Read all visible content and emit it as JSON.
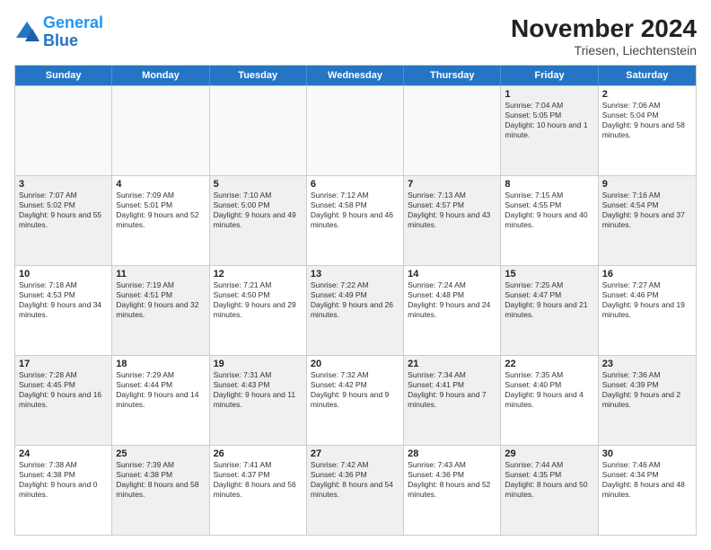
{
  "logo": {
    "line1": "General",
    "line2": "Blue"
  },
  "title": "November 2024",
  "location": "Triesen, Liechtenstein",
  "header_days": [
    "Sunday",
    "Monday",
    "Tuesday",
    "Wednesday",
    "Thursday",
    "Friday",
    "Saturday"
  ],
  "rows": [
    [
      {
        "day": "",
        "text": "",
        "empty": true
      },
      {
        "day": "",
        "text": "",
        "empty": true
      },
      {
        "day": "",
        "text": "",
        "empty": true
      },
      {
        "day": "",
        "text": "",
        "empty": true
      },
      {
        "day": "",
        "text": "",
        "empty": true
      },
      {
        "day": "1",
        "text": "Sunrise: 7:04 AM\nSunset: 5:05 PM\nDaylight: 10 hours and 1 minute.",
        "empty": false,
        "shaded": true
      },
      {
        "day": "2",
        "text": "Sunrise: 7:06 AM\nSunset: 5:04 PM\nDaylight: 9 hours and 58 minutes.",
        "empty": false,
        "shaded": false
      }
    ],
    [
      {
        "day": "3",
        "text": "Sunrise: 7:07 AM\nSunset: 5:02 PM\nDaylight: 9 hours and 55 minutes.",
        "empty": false,
        "shaded": true
      },
      {
        "day": "4",
        "text": "Sunrise: 7:09 AM\nSunset: 5:01 PM\nDaylight: 9 hours and 52 minutes.",
        "empty": false,
        "shaded": false
      },
      {
        "day": "5",
        "text": "Sunrise: 7:10 AM\nSunset: 5:00 PM\nDaylight: 9 hours and 49 minutes.",
        "empty": false,
        "shaded": true
      },
      {
        "day": "6",
        "text": "Sunrise: 7:12 AM\nSunset: 4:58 PM\nDaylight: 9 hours and 46 minutes.",
        "empty": false,
        "shaded": false
      },
      {
        "day": "7",
        "text": "Sunrise: 7:13 AM\nSunset: 4:57 PM\nDaylight: 9 hours and 43 minutes.",
        "empty": false,
        "shaded": true
      },
      {
        "day": "8",
        "text": "Sunrise: 7:15 AM\nSunset: 4:55 PM\nDaylight: 9 hours and 40 minutes.",
        "empty": false,
        "shaded": false
      },
      {
        "day": "9",
        "text": "Sunrise: 7:16 AM\nSunset: 4:54 PM\nDaylight: 9 hours and 37 minutes.",
        "empty": false,
        "shaded": true
      }
    ],
    [
      {
        "day": "10",
        "text": "Sunrise: 7:18 AM\nSunset: 4:53 PM\nDaylight: 9 hours and 34 minutes.",
        "empty": false,
        "shaded": false
      },
      {
        "day": "11",
        "text": "Sunrise: 7:19 AM\nSunset: 4:51 PM\nDaylight: 9 hours and 32 minutes.",
        "empty": false,
        "shaded": true
      },
      {
        "day": "12",
        "text": "Sunrise: 7:21 AM\nSunset: 4:50 PM\nDaylight: 9 hours and 29 minutes.",
        "empty": false,
        "shaded": false
      },
      {
        "day": "13",
        "text": "Sunrise: 7:22 AM\nSunset: 4:49 PM\nDaylight: 9 hours and 26 minutes.",
        "empty": false,
        "shaded": true
      },
      {
        "day": "14",
        "text": "Sunrise: 7:24 AM\nSunset: 4:48 PM\nDaylight: 9 hours and 24 minutes.",
        "empty": false,
        "shaded": false
      },
      {
        "day": "15",
        "text": "Sunrise: 7:25 AM\nSunset: 4:47 PM\nDaylight: 9 hours and 21 minutes.",
        "empty": false,
        "shaded": true
      },
      {
        "day": "16",
        "text": "Sunrise: 7:27 AM\nSunset: 4:46 PM\nDaylight: 9 hours and 19 minutes.",
        "empty": false,
        "shaded": false
      }
    ],
    [
      {
        "day": "17",
        "text": "Sunrise: 7:28 AM\nSunset: 4:45 PM\nDaylight: 9 hours and 16 minutes.",
        "empty": false,
        "shaded": true
      },
      {
        "day": "18",
        "text": "Sunrise: 7:29 AM\nSunset: 4:44 PM\nDaylight: 9 hours and 14 minutes.",
        "empty": false,
        "shaded": false
      },
      {
        "day": "19",
        "text": "Sunrise: 7:31 AM\nSunset: 4:43 PM\nDaylight: 9 hours and 11 minutes.",
        "empty": false,
        "shaded": true
      },
      {
        "day": "20",
        "text": "Sunrise: 7:32 AM\nSunset: 4:42 PM\nDaylight: 9 hours and 9 minutes.",
        "empty": false,
        "shaded": false
      },
      {
        "day": "21",
        "text": "Sunrise: 7:34 AM\nSunset: 4:41 PM\nDaylight: 9 hours and 7 minutes.",
        "empty": false,
        "shaded": true
      },
      {
        "day": "22",
        "text": "Sunrise: 7:35 AM\nSunset: 4:40 PM\nDaylight: 9 hours and 4 minutes.",
        "empty": false,
        "shaded": false
      },
      {
        "day": "23",
        "text": "Sunrise: 7:36 AM\nSunset: 4:39 PM\nDaylight: 9 hours and 2 minutes.",
        "empty": false,
        "shaded": true
      }
    ],
    [
      {
        "day": "24",
        "text": "Sunrise: 7:38 AM\nSunset: 4:38 PM\nDaylight: 9 hours and 0 minutes.",
        "empty": false,
        "shaded": false
      },
      {
        "day": "25",
        "text": "Sunrise: 7:39 AM\nSunset: 4:38 PM\nDaylight: 8 hours and 58 minutes.",
        "empty": false,
        "shaded": true
      },
      {
        "day": "26",
        "text": "Sunrise: 7:41 AM\nSunset: 4:37 PM\nDaylight: 8 hours and 56 minutes.",
        "empty": false,
        "shaded": false
      },
      {
        "day": "27",
        "text": "Sunrise: 7:42 AM\nSunset: 4:36 PM\nDaylight: 8 hours and 54 minutes.",
        "empty": false,
        "shaded": true
      },
      {
        "day": "28",
        "text": "Sunrise: 7:43 AM\nSunset: 4:36 PM\nDaylight: 8 hours and 52 minutes.",
        "empty": false,
        "shaded": false
      },
      {
        "day": "29",
        "text": "Sunrise: 7:44 AM\nSunset: 4:35 PM\nDaylight: 8 hours and 50 minutes.",
        "empty": false,
        "shaded": true
      },
      {
        "day": "30",
        "text": "Sunrise: 7:46 AM\nSunset: 4:34 PM\nDaylight: 8 hours and 48 minutes.",
        "empty": false,
        "shaded": false
      }
    ]
  ]
}
